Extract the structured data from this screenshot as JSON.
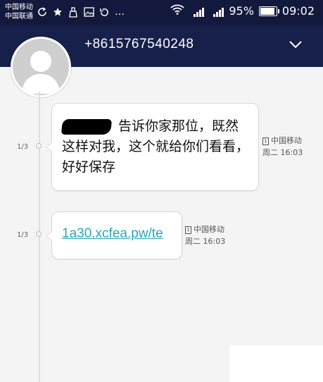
{
  "status_bar": {
    "carrier_1": "中国移动",
    "carrier_2": "中国联通",
    "more_icon": "…",
    "battery_percent": "95%",
    "time": "09:02",
    "icons": [
      "sync-icon",
      "star-icon",
      "cleaner-icon",
      "image-icon",
      "refresh-icon",
      "more-icon",
      "wifi-icon",
      "signal-icon",
      "battery-icon"
    ]
  },
  "conversation": {
    "contact_number": "+8615767540248",
    "avatar_icon": "person-avatar-icon",
    "expand_icon": "chevron-down-icon"
  },
  "messages": [
    {
      "count": "1/3",
      "text": "告诉你家那位，既然这样对我，这个就给你们看看，好好保存",
      "sim_badge": "1",
      "carrier": "中国移动",
      "time": "周二 16:03"
    },
    {
      "count": "1/3",
      "link_text": "1a30.xcfea.pw/te",
      "sim_badge": "1",
      "carrier": "中国移动",
      "time": "周二 16:03"
    }
  ],
  "colors": {
    "header_bg": "#17204a",
    "status_bg": "#12193c",
    "link": "#2aa7b4",
    "background": "#f4f4f4"
  }
}
